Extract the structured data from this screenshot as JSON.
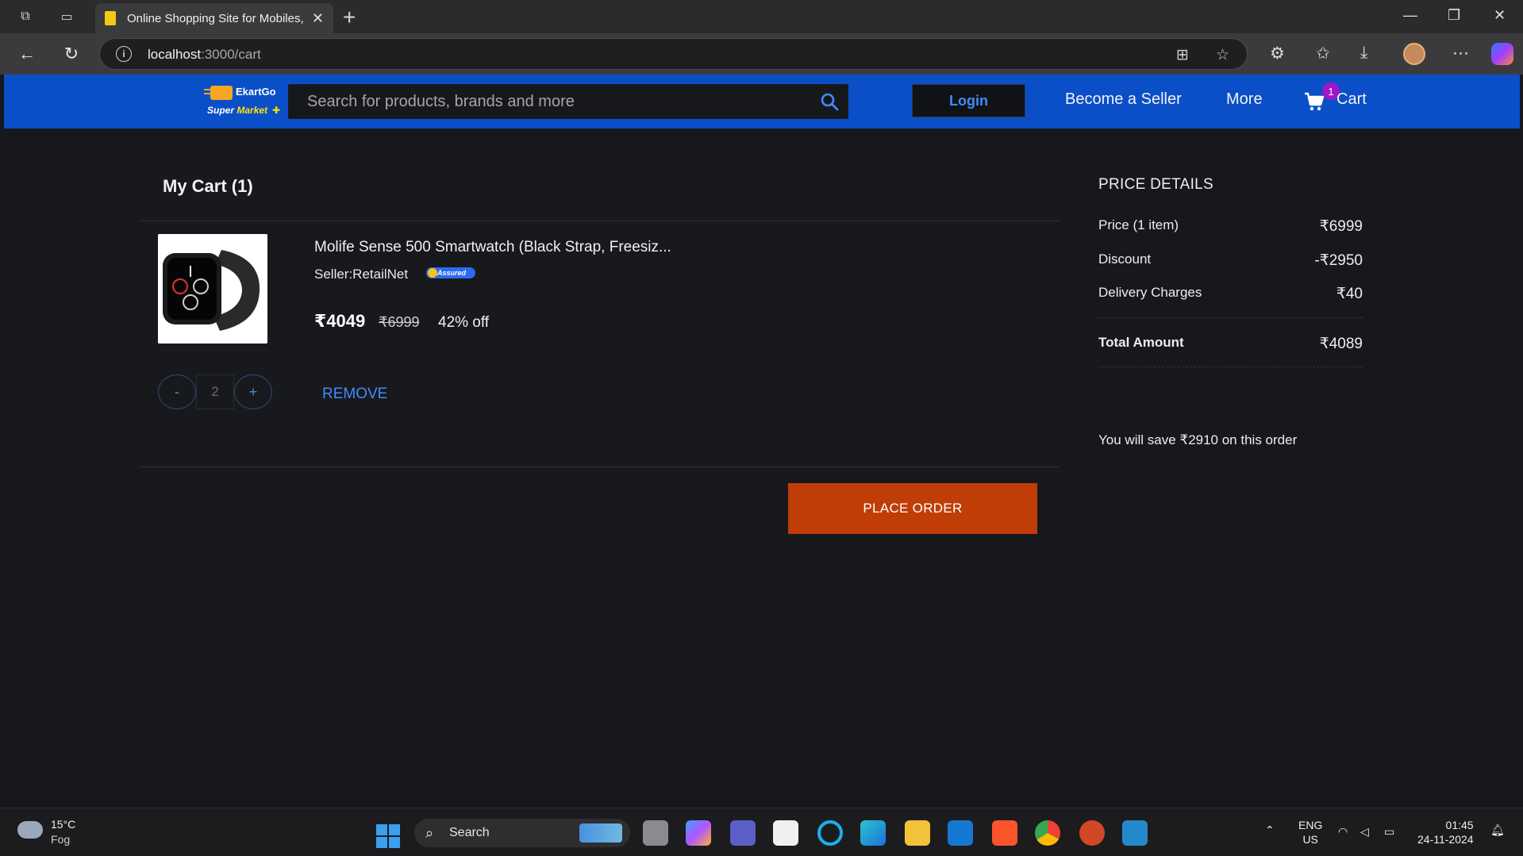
{
  "browser": {
    "tab_title": "Online Shopping Site for Mobiles,",
    "url_host": "localhost",
    "url_path": ":3000/cart"
  },
  "header": {
    "logo_name": "EkartGo",
    "logo_sub_1": "Super",
    "logo_sub_2": "Market",
    "search_placeholder": "Search for products, brands and more",
    "login_label": "Login",
    "seller_label": "Become a Seller",
    "more_label": "More",
    "cart_label": "Cart",
    "cart_count": "1"
  },
  "cart": {
    "title": "My Cart (1)",
    "item": {
      "name": "Molife Sense 500 Smartwatch (Black Strap, Freesiz...",
      "seller": "Seller:RetailNet",
      "assured": "Assured",
      "price": "₹4049",
      "mrp": "₹6999",
      "discount": "42% off",
      "qty_minus": "-",
      "quantity": "2",
      "qty_plus": "+",
      "remove_label": "REMOVE"
    },
    "place_order_label": "PLACE ORDER"
  },
  "price_details": {
    "title": "PRICE DETAILS",
    "price_label": "Price (1 item)",
    "price_value": "₹6999",
    "discount_label": "Discount",
    "discount_value": "-₹2950",
    "delivery_label": "Delivery Charges",
    "delivery_value": "₹40",
    "total_label": "Total Amount",
    "total_value": "₹4089",
    "savings_text": "You will save ₹2910 on this order"
  },
  "taskbar": {
    "temperature": "15°C",
    "weather": "Fog",
    "search_label": "Search",
    "lang_1": "ENG",
    "lang_2": "US",
    "time": "01:45",
    "date": "24-11-2024"
  },
  "colors": {
    "header_blue": "#0b4fc8",
    "accent_blue": "#3d8bff",
    "place_order": "#c03d07",
    "cart_badge": "#a017c8"
  }
}
